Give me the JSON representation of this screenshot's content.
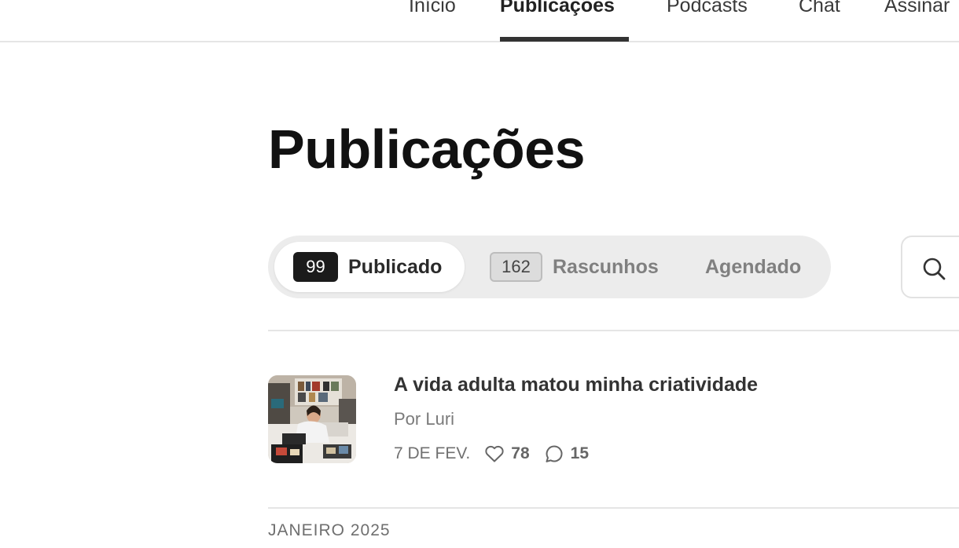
{
  "nav": {
    "items": [
      {
        "label": "Início"
      },
      {
        "label": "Publicações"
      },
      {
        "label": "Podcasts"
      },
      {
        "label": "Chat"
      },
      {
        "label": "Assinar"
      }
    ],
    "active": "Publicações"
  },
  "page": {
    "title": "Publicações"
  },
  "filters": {
    "published": {
      "count": "99",
      "label": "Publicado"
    },
    "drafts": {
      "count": "162",
      "label": "Rascunhos"
    },
    "scheduled": {
      "label": "Agendado"
    },
    "active": "Publicado"
  },
  "search": {
    "icon": "search-icon"
  },
  "posts": [
    {
      "title": "A vida adulta matou minha criatividade",
      "author": "Por Luri",
      "date": "7 DE FEV.",
      "likes": "78",
      "comments": "15",
      "like_icon": "heart-icon",
      "comment_icon": "comment-icon"
    }
  ],
  "sections": [
    {
      "label": "JANEIRO 2025"
    }
  ],
  "colors": {
    "active_badge": "#1b1b1b",
    "nav_underline": "#333333",
    "segment_bg": "#ececec"
  }
}
